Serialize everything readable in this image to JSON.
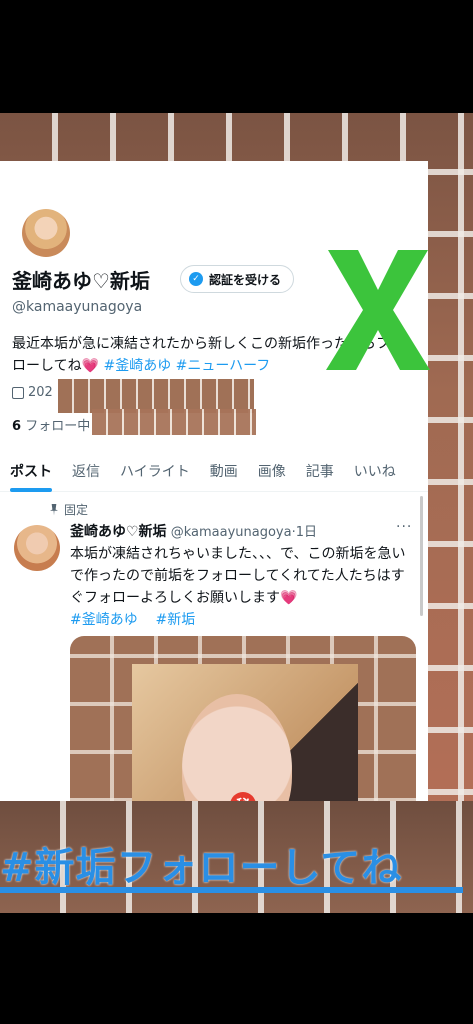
{
  "profile": {
    "name": "釜崎あゆ♡新垢",
    "verify_label": "認証を受ける",
    "handle": "@kamaayunagoya",
    "bio_text": "最近本垢が急に凍結されたから新しくこの新垢作ったからフォローしてね",
    "bio_heart": "💗",
    "bio_tags": [
      "#釜崎あゆ",
      "#ニューハーフ"
    ],
    "join_partial": "202",
    "following_count": "6",
    "following_label": "フォロー中"
  },
  "tabs": [
    "ポスト",
    "返信",
    "ハイライト",
    "動画",
    "画像",
    "記事",
    "いいね"
  ],
  "pinned_label": "固定",
  "post": {
    "author": "釜崎あゆ♡新垢",
    "handle_time": "@kamaayunagoya·1日",
    "text": "本垢が凍結されちゃいました、、、で、この新垢を急いで作ったので前垢をフォローしてくれてた人たちはすぐフォローよろしくお願いします",
    "heart": "💗",
    "tags": [
      "#釜崎あゆ",
      "#新垢"
    ],
    "more": "···",
    "image_seal": "秘"
  },
  "overlay": {
    "caption": "#新垢フォローしてね",
    "x_color": "#3cc43c",
    "caption_color": "#2a8fe5"
  }
}
